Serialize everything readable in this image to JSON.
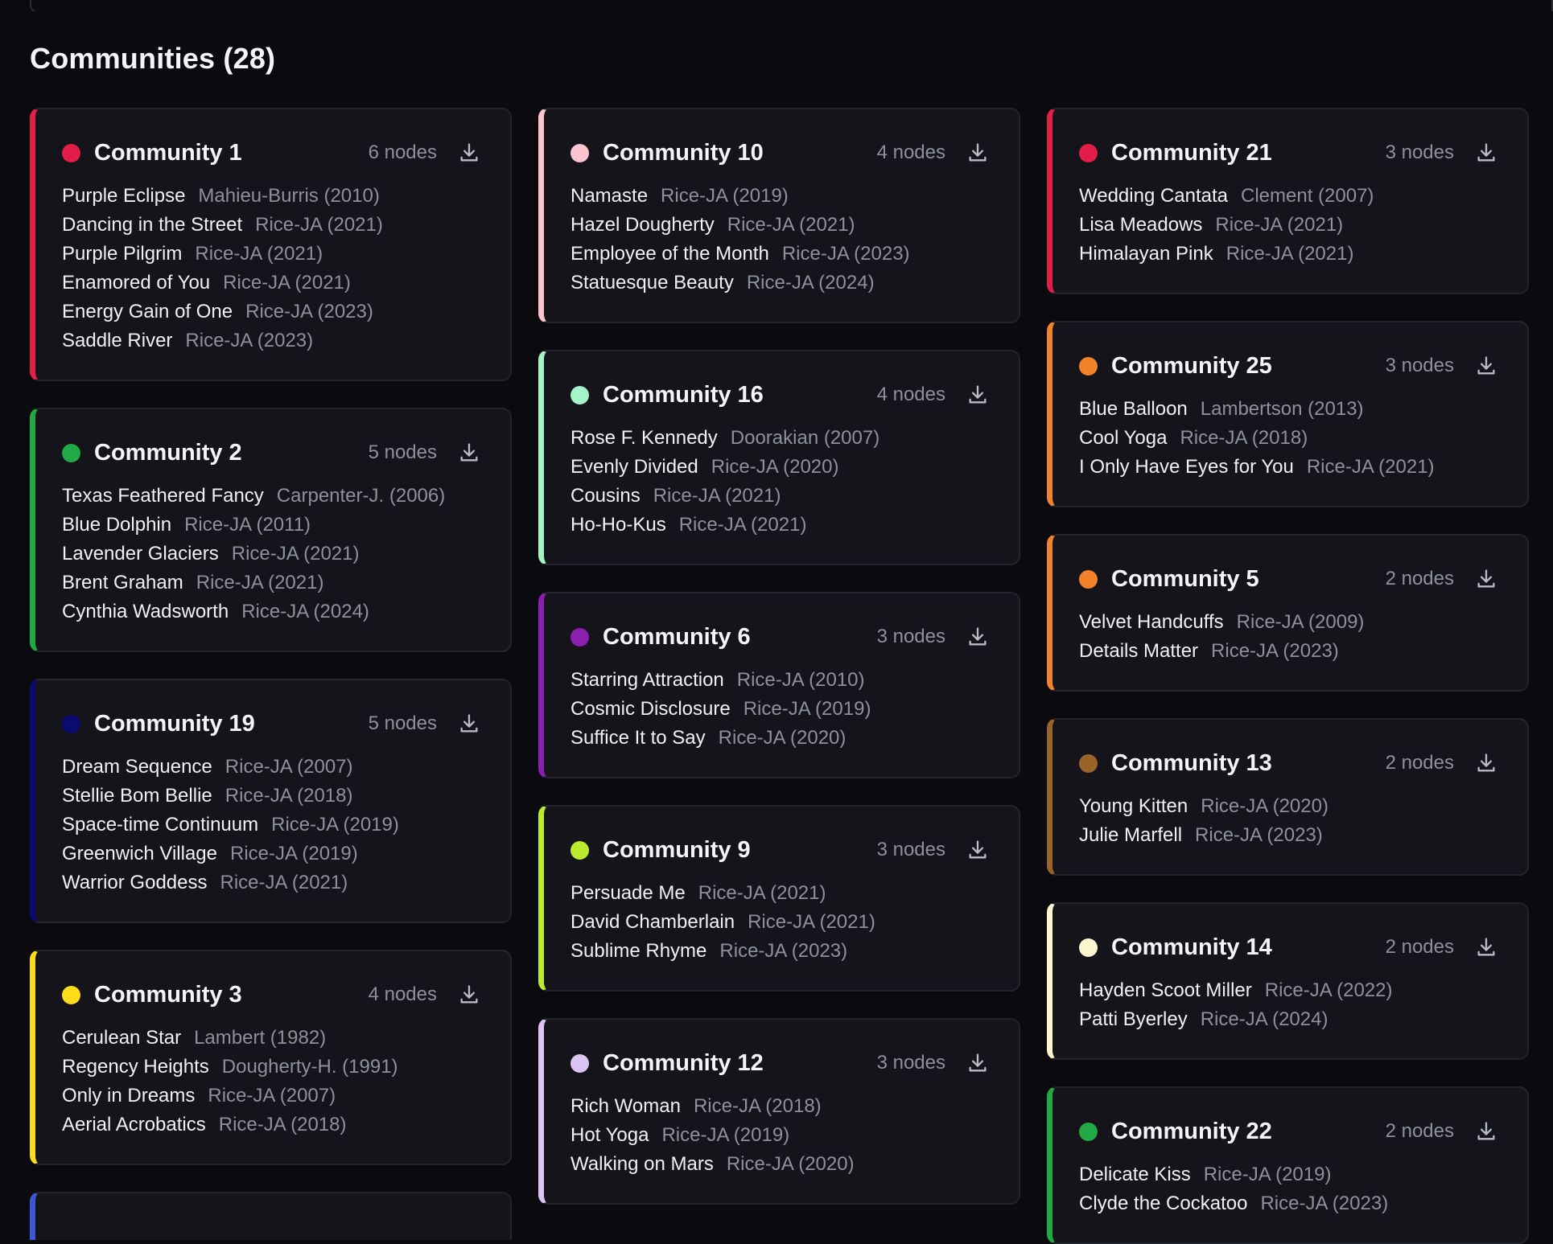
{
  "page": {
    "title": "Communities (28)"
  },
  "columns": [
    {
      "cards": [
        {
          "title": "Community 1",
          "count": "6 nodes",
          "color": "#e11d48",
          "members": [
            {
              "name": "Purple Eclipse",
              "meta": "Mahieu-Burris (2010)"
            },
            {
              "name": "Dancing in the Street",
              "meta": "Rice-JA (2021)"
            },
            {
              "name": "Purple Pilgrim",
              "meta": "Rice-JA (2021)"
            },
            {
              "name": "Enamored of You",
              "meta": "Rice-JA (2021)"
            },
            {
              "name": "Energy Gain of One",
              "meta": "Rice-JA (2023)"
            },
            {
              "name": "Saddle River",
              "meta": "Rice-JA (2023)"
            }
          ]
        },
        {
          "title": "Community 2",
          "count": "5 nodes",
          "color": "#22a845",
          "members": [
            {
              "name": "Texas Feathered Fancy",
              "meta": "Carpenter-J. (2006)"
            },
            {
              "name": "Blue Dolphin",
              "meta": "Rice-JA (2011)"
            },
            {
              "name": "Lavender Glaciers",
              "meta": "Rice-JA (2021)"
            },
            {
              "name": "Brent Graham",
              "meta": "Rice-JA (2021)"
            },
            {
              "name": "Cynthia Wadsworth",
              "meta": "Rice-JA (2024)"
            }
          ]
        },
        {
          "title": "Community 19",
          "count": "5 nodes",
          "color": "#0b0a6e",
          "members": [
            {
              "name": "Dream Sequence",
              "meta": "Rice-JA (2007)"
            },
            {
              "name": "Stellie Bom Bellie",
              "meta": "Rice-JA (2018)"
            },
            {
              "name": "Space-time Continuum",
              "meta": "Rice-JA (2019)"
            },
            {
              "name": "Greenwich Village",
              "meta": "Rice-JA (2019)"
            },
            {
              "name": "Warrior Goddess",
              "meta": "Rice-JA (2021)"
            }
          ]
        },
        {
          "title": "Community 3",
          "count": "4 nodes",
          "color": "#fadd18",
          "members": [
            {
              "name": "Cerulean Star",
              "meta": "Lambert (1982)"
            },
            {
              "name": "Regency Heights",
              "meta": "Dougherty-H. (1991)"
            },
            {
              "name": "Only in Dreams",
              "meta": "Rice-JA (2007)"
            },
            {
              "name": "Aerial Acrobatics",
              "meta": "Rice-JA (2018)"
            }
          ]
        }
      ],
      "partial_color": "#3d56d6"
    },
    {
      "cards": [
        {
          "title": "Community 10",
          "count": "4 nodes",
          "color": "#fbc4cf",
          "members": [
            {
              "name": "Namaste",
              "meta": "Rice-JA (2019)"
            },
            {
              "name": "Hazel Dougherty",
              "meta": "Rice-JA (2021)"
            },
            {
              "name": "Employee of the Month",
              "meta": "Rice-JA (2023)"
            },
            {
              "name": "Statuesque Beauty",
              "meta": "Rice-JA (2024)"
            }
          ]
        },
        {
          "title": "Community 16",
          "count": "4 nodes",
          "color": "#a7f3c8",
          "members": [
            {
              "name": "Rose F. Kennedy",
              "meta": "Doorakian (2007)"
            },
            {
              "name": "Evenly Divided",
              "meta": "Rice-JA (2020)"
            },
            {
              "name": "Cousins",
              "meta": "Rice-JA (2021)"
            },
            {
              "name": "Ho-Ho-Kus",
              "meta": "Rice-JA (2021)"
            }
          ]
        },
        {
          "title": "Community 6",
          "count": "3 nodes",
          "color": "#8a1fb0",
          "members": [
            {
              "name": "Starring Attraction",
              "meta": "Rice-JA (2010)"
            },
            {
              "name": "Cosmic Disclosure",
              "meta": "Rice-JA (2019)"
            },
            {
              "name": "Suffice It to Say",
              "meta": "Rice-JA (2020)"
            }
          ]
        },
        {
          "title": "Community 9",
          "count": "3 nodes",
          "color": "#bdea2f",
          "members": [
            {
              "name": "Persuade Me",
              "meta": "Rice-JA (2021)"
            },
            {
              "name": "David Chamberlain",
              "meta": "Rice-JA (2021)"
            },
            {
              "name": "Sublime Rhyme",
              "meta": "Rice-JA (2023)"
            }
          ]
        },
        {
          "title": "Community 12",
          "count": "3 nodes",
          "color": "#dcc4f5",
          "members": [
            {
              "name": "Rich Woman",
              "meta": "Rice-JA (2018)"
            },
            {
              "name": "Hot Yoga",
              "meta": "Rice-JA (2019)"
            },
            {
              "name": "Walking on Mars",
              "meta": "Rice-JA (2020)"
            }
          ]
        }
      ]
    },
    {
      "cards": [
        {
          "title": "Community 21",
          "count": "3 nodes",
          "color": "#e11d48",
          "members": [
            {
              "name": "Wedding Cantata",
              "meta": "Clement (2007)"
            },
            {
              "name": "Lisa Meadows",
              "meta": "Rice-JA (2021)"
            },
            {
              "name": "Himalayan Pink",
              "meta": "Rice-JA (2021)"
            }
          ]
        },
        {
          "title": "Community 25",
          "count": "3 nodes",
          "color": "#f2832a",
          "members": [
            {
              "name": "Blue Balloon",
              "meta": "Lambertson (2013)"
            },
            {
              "name": "Cool Yoga",
              "meta": "Rice-JA (2018)"
            },
            {
              "name": "I Only Have Eyes for You",
              "meta": "Rice-JA (2021)"
            }
          ]
        },
        {
          "title": "Community 5",
          "count": "2 nodes",
          "color": "#f2832a",
          "members": [
            {
              "name": "Velvet Handcuffs",
              "meta": "Rice-JA (2009)"
            },
            {
              "name": "Details Matter",
              "meta": "Rice-JA (2023)"
            }
          ]
        },
        {
          "title": "Community 13",
          "count": "2 nodes",
          "color": "#9a6328",
          "members": [
            {
              "name": "Young Kitten",
              "meta": "Rice-JA (2020)"
            },
            {
              "name": "Julie Marfell",
              "meta": "Rice-JA (2023)"
            }
          ]
        },
        {
          "title": "Community 14",
          "count": "2 nodes",
          "color": "#fdf7cf",
          "members": [
            {
              "name": "Hayden Scoot Miller",
              "meta": "Rice-JA (2022)"
            },
            {
              "name": "Patti Byerley",
              "meta": "Rice-JA (2024)"
            }
          ]
        },
        {
          "title": "Community 22",
          "count": "2 nodes",
          "color": "#22a845",
          "members": [
            {
              "name": "Delicate Kiss",
              "meta": "Rice-JA (2019)"
            },
            {
              "name": "Clyde the Cockatoo",
              "meta": "Rice-JA (2023)"
            }
          ]
        }
      ]
    }
  ]
}
